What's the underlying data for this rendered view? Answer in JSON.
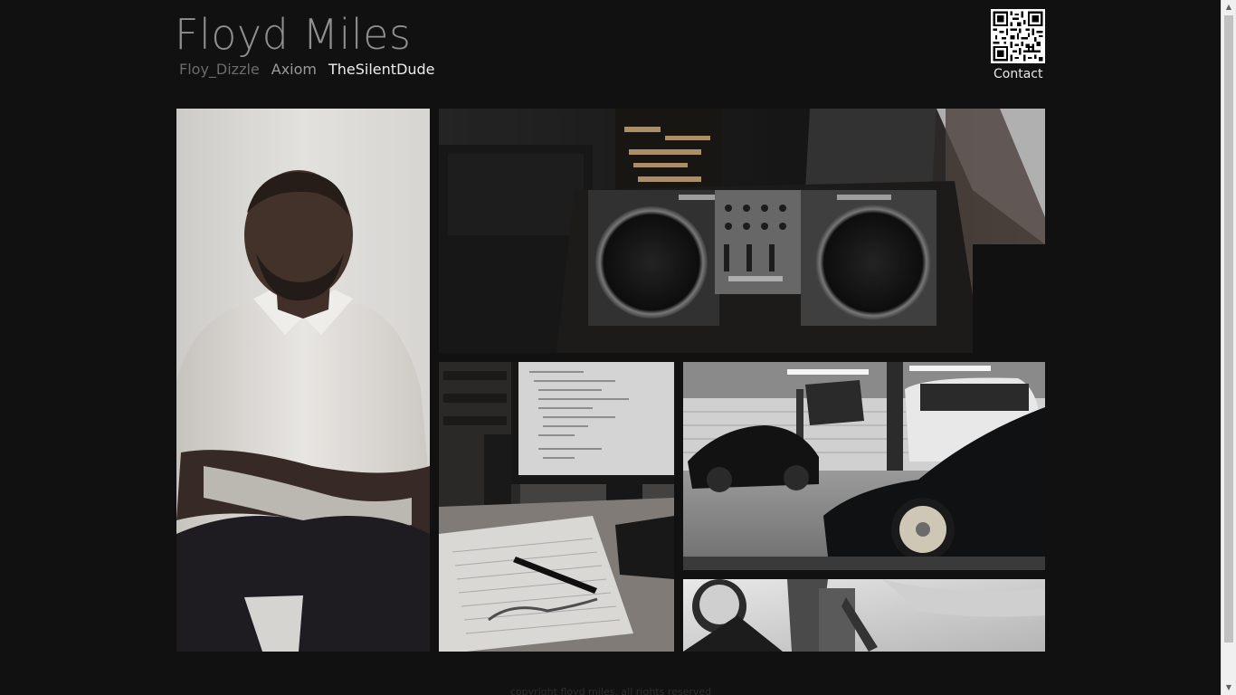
{
  "header": {
    "title": "Floyd Miles",
    "nav": [
      {
        "label": "Floy_Dizzle",
        "state": "dim"
      },
      {
        "label": "Axiom",
        "state": "mid"
      },
      {
        "label": "TheSilentDude",
        "state": "active"
      }
    ],
    "contact_label": "Contact",
    "qr_icon": "qr-code-icon"
  },
  "gallery": {
    "photos": [
      {
        "name": "portrait-photo",
        "subject": "man in white polo with crossed arms"
      },
      {
        "name": "turntables-photo",
        "subject": "DJ turntables and mixer"
      },
      {
        "name": "desk-photo",
        "subject": "monitor, keyboard, notepad and pen"
      },
      {
        "name": "garage-photo",
        "subject": "cars in a service garage"
      },
      {
        "name": "sky-photo",
        "subject": "stadium light and sky"
      }
    ]
  },
  "footer": {
    "text": "copyright floyd miles. all rights reserved"
  },
  "colors": {
    "background": "#111112",
    "title": "#8f8f8f",
    "nav_active": "#ececec",
    "nav_dim": "#6b6b6b"
  }
}
